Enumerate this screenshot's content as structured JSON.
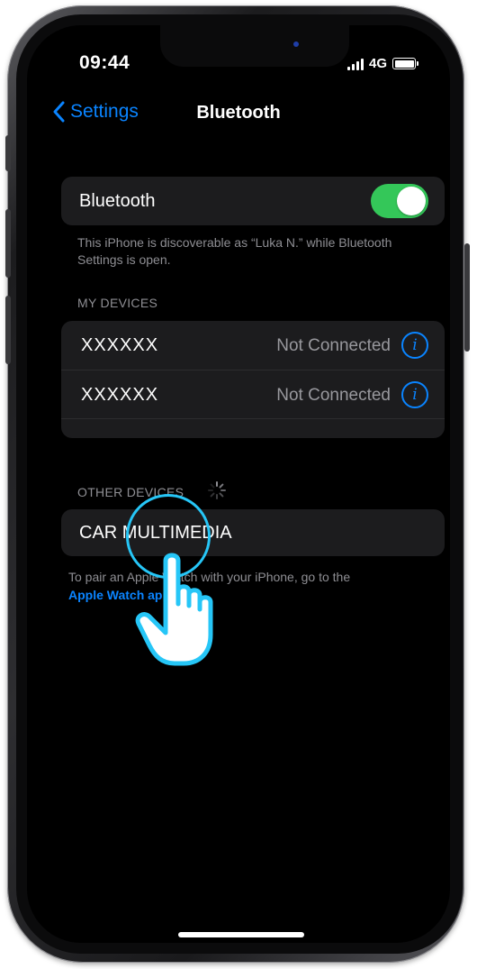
{
  "status_bar": {
    "time": "09:44",
    "network": "4G"
  },
  "nav": {
    "back_label": "Settings",
    "title": "Bluetooth"
  },
  "bluetooth": {
    "label": "Bluetooth",
    "enabled": true,
    "footnote": "This iPhone is discoverable as “Luka N.” while Bluetooth Settings is open."
  },
  "my_devices": {
    "header": "MY DEVICES",
    "items": [
      {
        "name": "XXXXXX",
        "status": "Not Connected"
      },
      {
        "name": "XXXXXX",
        "status": "Not Connected"
      }
    ]
  },
  "other_devices": {
    "header": "OTHER DEVICES",
    "items": [
      {
        "name": "CAR MULTIMEDIA"
      }
    ]
  },
  "pair_note": {
    "text": "To pair an Apple Watch with your iPhone, go to the",
    "link": "Apple Watch app."
  },
  "colors": {
    "accent": "#0a84ff",
    "toggle_on": "#34c759",
    "tap_highlight": "#26c6f7"
  },
  "icons": [
    "chevron-left-icon",
    "signal-icon",
    "battery-icon",
    "info-icon",
    "spinner-icon",
    "tap-hand-icon"
  ]
}
